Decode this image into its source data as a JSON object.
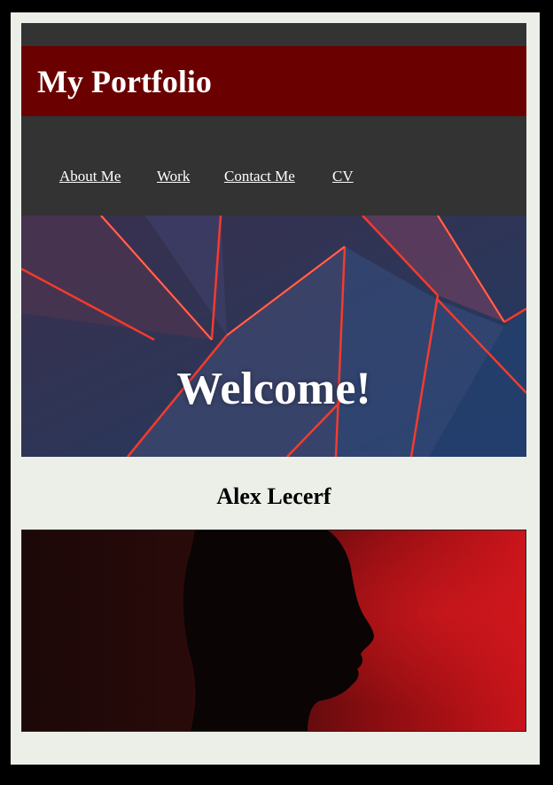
{
  "site": {
    "title": "My Portfolio"
  },
  "nav": {
    "items": [
      {
        "label": "About Me"
      },
      {
        "label": "Work"
      },
      {
        "label": "Contact Me"
      },
      {
        "label": "CV"
      }
    ]
  },
  "hero": {
    "heading": "Welcome!"
  },
  "profile": {
    "name": "Alex Lecerf"
  },
  "colors": {
    "header_bg": "#6b0000",
    "nav_bg": "#333333",
    "page_bg": "#eceee8",
    "accent_red": "#e52a1a"
  }
}
